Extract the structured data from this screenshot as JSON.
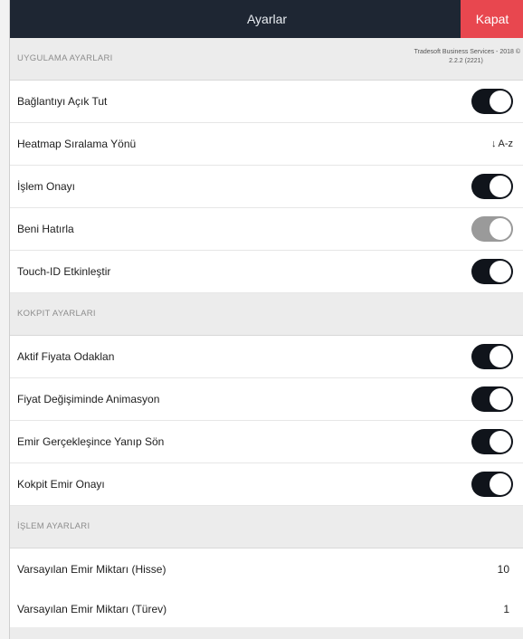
{
  "header": {
    "title": "Ayarlar",
    "close_label": "Kapat"
  },
  "sections": {
    "app": {
      "title": "UYGULAMA AYARLARI",
      "copyright": "Tradesoft Business Services - 2018 ©",
      "version": "2.2.2 (2221)"
    },
    "cockpit": {
      "title": "KOKPIT AYARLARI"
    },
    "trade": {
      "title": "İŞLEM AYARLARI"
    }
  },
  "rows": {
    "keep_alive": {
      "label": "Bağlantıyı Açık Tut",
      "on": true
    },
    "heatmap_sort": {
      "label": "Heatmap Sıralama Yönü",
      "arrow": "↓",
      "value": "A-z"
    },
    "trade_confirm": {
      "label": "İşlem Onayı",
      "on": true
    },
    "remember_me": {
      "label": "Beni Hatırla",
      "on": true,
      "disabled": true
    },
    "touch_id": {
      "label": "Touch-ID Etkinleştir",
      "on": true
    },
    "focus_price": {
      "label": "Aktif Fiyata Odaklan",
      "on": true
    },
    "price_anim": {
      "label": "Fiyat Değişiminde Animasyon",
      "on": true
    },
    "order_blink": {
      "label": "Emir Gerçekleşince Yanıp Sön",
      "on": true
    },
    "cockpit_confirm": {
      "label": "Kokpit Emir Onayı",
      "on": true
    },
    "default_qty_stock": {
      "label": "Varsayılan Emir Miktarı (Hisse)",
      "value": "10"
    },
    "default_qty_deriv": {
      "label": "Varsayılan Emir Miktarı (Türev)",
      "value": "1"
    }
  },
  "colors": {
    "titlebar": "#1e2633",
    "close_button": "#e8474f",
    "toggle_on": "#10141b",
    "toggle_disabled": "#9a9a9a",
    "section_bg": "#ececec"
  }
}
